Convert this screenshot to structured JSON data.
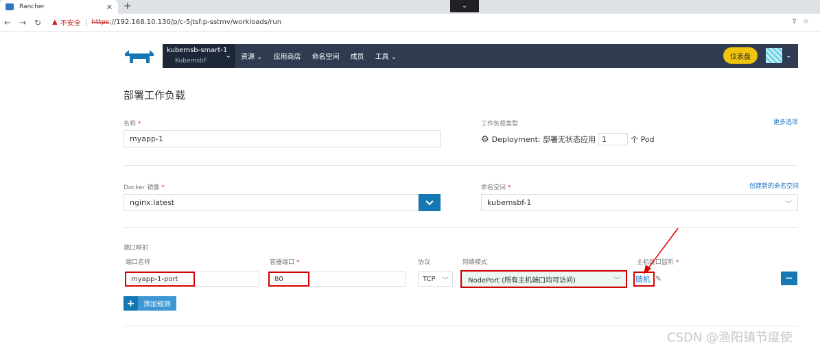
{
  "browser": {
    "tab_title": "Rancher",
    "tab_close": "✕",
    "new_tab": "+",
    "tab_menu": "⌄",
    "back": "←",
    "forward": "→",
    "reload": "↻",
    "warning_label": "不安全",
    "url_protocol": "https",
    "url_rest": "://192.168.10.130/p/c-5jtsf:p-sstmv/workloads/run",
    "right_icons": "⇪☆"
  },
  "header": {
    "cluster_name": "kubemsb-smart-1",
    "project_name": "KubemsbF",
    "chevron": "⌄",
    "menu": [
      {
        "label": "资源 ⌄"
      },
      {
        "label": "应用商店"
      },
      {
        "label": "命名空间"
      },
      {
        "label": "成员"
      },
      {
        "label": "工具 ⌄"
      }
    ],
    "dashboard_label": "仪表盘",
    "colors": {
      "bar": "#2e3b50",
      "cluster_bg": "#1d2738",
      "dashboard": "#f1c40f"
    }
  },
  "page": {
    "title": "部署工作负载",
    "name_label": "名称",
    "required": "*",
    "name_value": "myapp-1",
    "workload_type_label": "工作负载类型",
    "more_options": "更多选项",
    "deployment_text": "Deployment: 部署无状态应用",
    "pod_count": "1",
    "pod_unit": "个 Pod",
    "docker_image_label": "Docker 镜像",
    "docker_image_value": "nginx:latest",
    "namespace_label": "命名空间",
    "create_namespace": "创建新的命名空间",
    "namespace_value": "kubemsbf-1",
    "port_mapping_label": "端口映射",
    "port_name_label": "端口名称",
    "container_port_label": "容器端口",
    "protocol_label": "协议",
    "network_mode_label": "网络模式",
    "host_port_label": "主机端口监听",
    "port_name_value": "myapp-1-port",
    "container_port_value": "80",
    "protocol_value": "TCP",
    "network_mode_value": "NodePort (所有主机端口均可访问)",
    "host_port_value": "随机",
    "add_rule_label": "添加规则",
    "add_rule_icon": "+",
    "remove_icon": "−",
    "edit_icon": "✎",
    "watermark": "CSDN @渔阳镇节度使",
    "colors": {
      "primary": "#1577b3",
      "highlight": "#d40000"
    }
  }
}
